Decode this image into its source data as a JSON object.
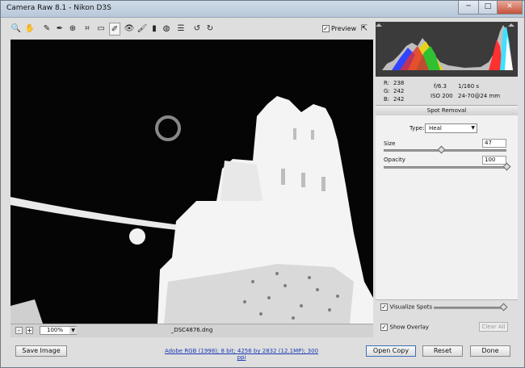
{
  "window": {
    "title": "Camera Raw 8.1  -  Nikon D3S",
    "minimize": "─",
    "maximize": "□",
    "close": "✕"
  },
  "toolbar": {
    "tools": [
      {
        "name": "zoom-tool",
        "glyph": "🔍"
      },
      {
        "name": "hand-tool",
        "glyph": "✋"
      },
      {
        "name": "white-balance-tool",
        "glyph": "✎"
      },
      {
        "name": "color-sampler-tool",
        "glyph": "✒"
      },
      {
        "name": "targeted-adjustment-tool",
        "glyph": "⊕"
      },
      {
        "name": "crop-tool",
        "glyph": "⌗"
      },
      {
        "name": "straighten-tool",
        "glyph": "▭"
      },
      {
        "name": "spot-removal-tool",
        "glyph": "✐"
      },
      {
        "name": "red-eye-tool",
        "glyph": "👁"
      },
      {
        "name": "adjustment-brush-tool",
        "glyph": "🖌"
      },
      {
        "name": "graduated-filter-tool",
        "glyph": "▮"
      },
      {
        "name": "radial-filter-tool",
        "glyph": "◍"
      },
      {
        "name": "preferences-icon",
        "glyph": "☰"
      },
      {
        "name": "rotate-left-icon",
        "glyph": "↺"
      },
      {
        "name": "rotate-right-icon",
        "glyph": "↻"
      }
    ],
    "preview_label": "Preview",
    "preview_checked": "✓",
    "fullscreen_glyph": "⇱"
  },
  "status": {
    "zoom_minus": "-",
    "zoom_plus": "+",
    "zoom_value": "100%",
    "zoom_arrow": "▼",
    "filename": "_DSC4876.dng"
  },
  "info": {
    "r_label": "R:",
    "r_value": "238",
    "g_label": "G:",
    "g_value": "242",
    "b_label": "B:",
    "b_value": "242",
    "aperture": "f/6.3",
    "shutter": "1/160 s",
    "iso": "ISO 200",
    "lens": "24-70@24 mm"
  },
  "panel": {
    "title": "Spot Removal",
    "type_label": "Type:",
    "type_value": "Heal",
    "type_arrow": "▼",
    "size_label": "Size",
    "size_value": "47",
    "size_level": 0.47,
    "opacity_label": "Opacity",
    "opacity_value": "100",
    "opacity_level": 1.0,
    "visualize_label": "Visualize Spots",
    "visualize_checked": "✓",
    "visualize_level": 0.95,
    "overlay_label": "Show Overlay",
    "overlay_checked": "✓",
    "clear_all": "Clear All"
  },
  "footer": {
    "save_image": "Save Image",
    "workflow_link": "Adobe RGB (1998); 8 bit; 4256 by 2832 (12.1MP); 300 ppi",
    "open_copy": "Open Copy",
    "reset": "Reset",
    "done": "Done"
  }
}
